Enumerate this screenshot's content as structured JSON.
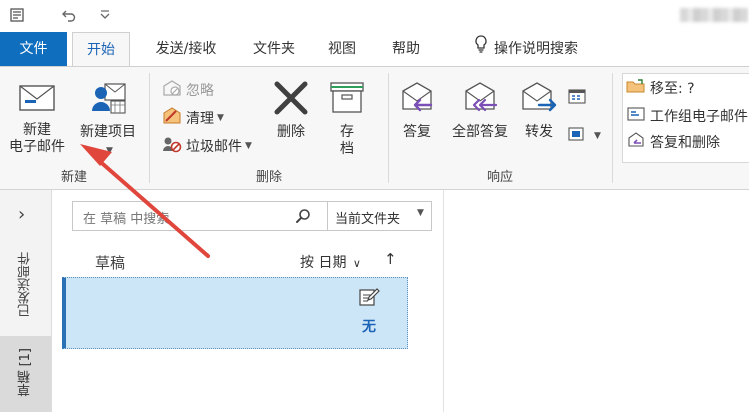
{
  "ribbon_tabs": [
    "文件",
    "开始",
    "发送/接收",
    "文件夹",
    "视图",
    "帮助",
    "操作说明搜索"
  ],
  "groups": {
    "new": {
      "label": "新建",
      "new_email_line1": "新建",
      "new_email_line2": "电子邮件",
      "new_items": "新建项目"
    },
    "delete": {
      "label": "删除",
      "ignore": "忽略",
      "cleanup": "清理",
      "junk": "垃圾邮件",
      "delete": "删除",
      "archive_line1": "存",
      "archive_line2": "档"
    },
    "respond": {
      "label": "响应",
      "reply": "答复",
      "reply_all": "全部答复",
      "forward": "转发"
    },
    "quick_steps": {
      "move_to": "移至: ?",
      "team_email": "工作组电子邮件",
      "reply_delete": "答复和删除"
    }
  },
  "nav_pane": {
    "expand_chevron": "›",
    "sent": "已发送邮件",
    "drafts": "草稿 [1]"
  },
  "search": {
    "placeholder": "在 草稿 中搜索",
    "scope": "当前文件夹"
  },
  "mail_list": {
    "folder_title": "草稿",
    "sort_label": "按 日期",
    "sort_direction": "↑",
    "items": [
      {
        "recipient": "无"
      }
    ]
  },
  "colors": {
    "file_tab": "#106ebe",
    "accent": "#1a63b5",
    "selected_item": "#cde6f7",
    "annotation_arrow": "#e0463c"
  }
}
